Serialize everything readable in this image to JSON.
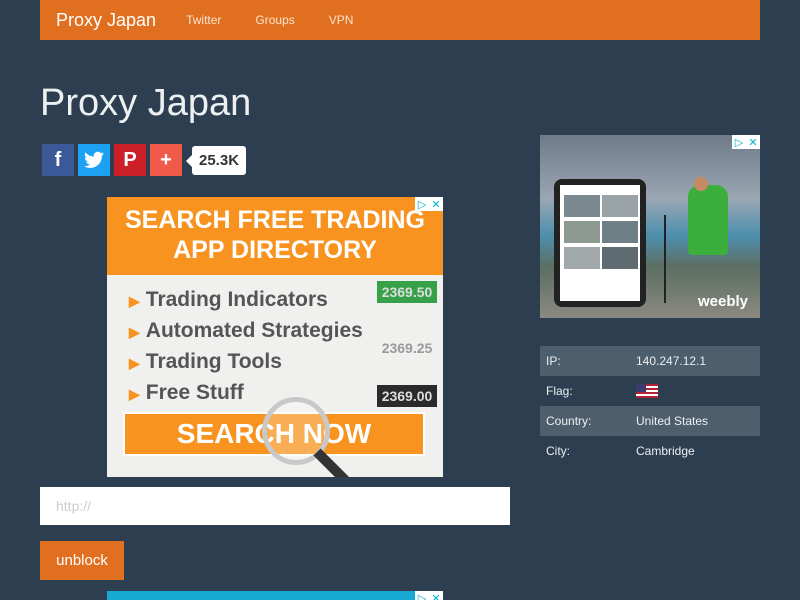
{
  "navbar": {
    "brand": "Proxy Japan",
    "links": [
      "Twitter",
      "Groups",
      "VPN"
    ],
    "color": "#e07020"
  },
  "page": {
    "title": "Proxy Japan"
  },
  "share": {
    "buttons": [
      {
        "icon": "facebook-icon",
        "glyph": "f"
      },
      {
        "icon": "twitter-icon",
        "glyph": "t"
      },
      {
        "icon": "pinterest-icon",
        "glyph": "P"
      },
      {
        "icon": "plus-icon",
        "glyph": "+"
      }
    ],
    "count": "25.3K"
  },
  "ad_main": {
    "headline_line1": "SEARCH FREE TRADING",
    "headline_line2": "APP DIRECTORY",
    "bullets": [
      "Trading Indicators",
      "Automated Strategies",
      "Trading Tools",
      "Free Stuff"
    ],
    "tickers": [
      "2369.50",
      "2369.25",
      "2369.00"
    ],
    "cta": "SEARCH NOW"
  },
  "ad_side": {
    "brand": "weebly"
  },
  "form": {
    "url_placeholder": "http://",
    "url_value": "",
    "submit_label": "unblock"
  },
  "info": {
    "ip_label": "IP:",
    "ip_value": "140.247.12.1",
    "flag_label": "Flag:",
    "flag_icon": "us-flag-icon",
    "country_label": "Country:",
    "country_value": "United States",
    "city_label": "City:",
    "city_value": "Cambridge"
  },
  "colors": {
    "background": "#2c3e50",
    "accent": "#e07020",
    "table_row": "#4d5e6d"
  }
}
